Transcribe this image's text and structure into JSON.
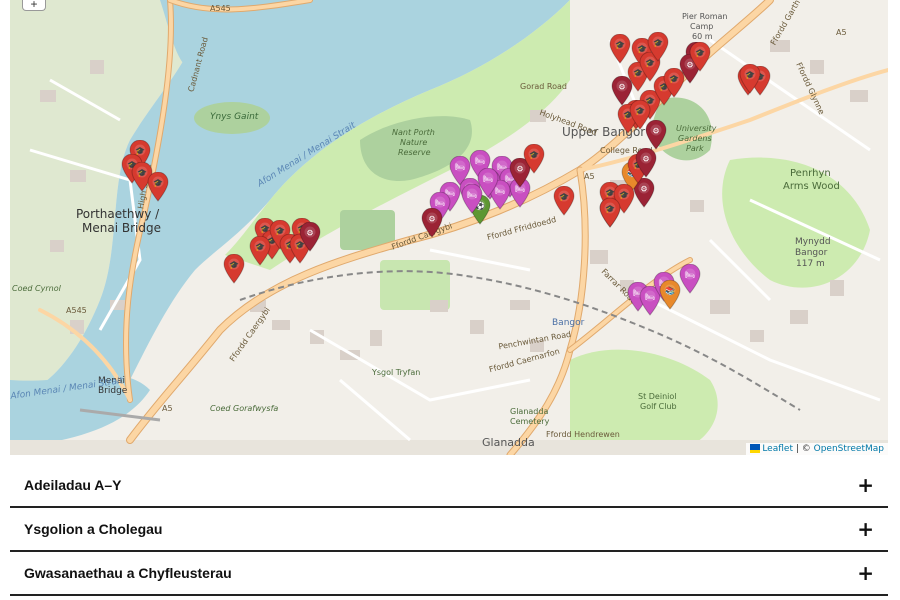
{
  "map": {
    "zoom_in_label": "+",
    "place_labels": [
      {
        "text": "Porthaethwy /",
        "size": 12,
        "color": "#333"
      },
      {
        "text": "Menai Bridge",
        "size": 12,
        "color": "#333"
      },
      {
        "text": "Upper Bangor",
        "size": 12,
        "color": "#555"
      },
      {
        "text": "Bangor",
        "size": 9,
        "color": "#4a6fa5"
      },
      {
        "text": "Glanadda",
        "size": 11,
        "color": "#555"
      },
      {
        "text": "Penrhyn",
        "size": 10,
        "color": "#4a6b3a"
      },
      {
        "text": "Arms Wood",
        "size": 10,
        "color": "#4a6b3a"
      },
      {
        "text": "Mynydd",
        "size": 9,
        "color": "#555"
      },
      {
        "text": "Bangor",
        "size": 9,
        "color": "#555"
      },
      {
        "text": "117 m",
        "size": 9,
        "color": "#555"
      },
      {
        "text": "Ynys Gaint",
        "size": 9,
        "color": "#3a6a3a"
      },
      {
        "text": "Menai",
        "size": 9,
        "color": "#333"
      },
      {
        "text": "Bridge",
        "size": 9,
        "color": "#333"
      },
      {
        "text": "Afon Menai / Menai Strait",
        "size": 9,
        "color": "#5b87b5"
      },
      {
        "text": "Afon Menai / Menai Strait",
        "size": 9,
        "color": "#5b87b5"
      },
      {
        "text": "Nant Porth",
        "size": 8,
        "color": "#4a6b3a"
      },
      {
        "text": "Nature",
        "size": 8,
        "color": "#4a6b3a"
      },
      {
        "text": "Reserve",
        "size": 8,
        "color": "#4a6b3a"
      },
      {
        "text": "St Deiniol",
        "size": 8,
        "color": "#4a6b3a"
      },
      {
        "text": "Golf Club",
        "size": 8,
        "color": "#4a6b3a"
      },
      {
        "text": "Coed Gorafwysfa",
        "size": 8,
        "color": "#4a6b3a"
      },
      {
        "text": "Ysgol Tryfan",
        "size": 8,
        "color": "#4a6b3a"
      },
      {
        "text": "Glanadda",
        "size": 8,
        "color": "#4a6b3a"
      },
      {
        "text": "Cemetery",
        "size": 8,
        "color": "#4a6b3a"
      },
      {
        "text": "University",
        "size": 8,
        "color": "#4a6b3a"
      },
      {
        "text": "Gardens",
        "size": 8,
        "color": "#4a6b3a"
      },
      {
        "text": "Park",
        "size": 8,
        "color": "#4a6b3a"
      },
      {
        "text": "Pier Roman",
        "size": 8,
        "color": "#555"
      },
      {
        "text": "Camp",
        "size": 8,
        "color": "#555"
      },
      {
        "text": "60 m",
        "size": 8,
        "color": "#555"
      },
      {
        "text": "Coed Cyrnol",
        "size": 8,
        "color": "#4a6b3a"
      }
    ],
    "road_labels": [
      "A545",
      "A545",
      "A5",
      "A5",
      "A5",
      "Ffordd Caergybi",
      "Ffordd Caergybi",
      "Ffordd Caernarfon",
      "Farrar Road",
      "Ffordd Ffriddoedd",
      "Penchwintan Road",
      "Gorad Road",
      "Holyhead Road",
      "College Road",
      "Ffordd Garth",
      "Ffordd Glynne",
      "High Street",
      "Cadnant Road",
      "Ffordd Hendrewen"
    ],
    "markers": [
      {
        "type": "education",
        "color": "#d63a2f"
      },
      {
        "type": "education",
        "color": "#d63a2f"
      },
      {
        "type": "education",
        "color": "#d63a2f"
      },
      {
        "type": "education",
        "color": "#d63a2f"
      },
      {
        "type": "education",
        "color": "#d63a2f"
      },
      {
        "type": "education",
        "color": "#d63a2f"
      },
      {
        "type": "education",
        "color": "#d63a2f"
      },
      {
        "type": "education",
        "color": "#d63a2f"
      },
      {
        "type": "education",
        "color": "#d63a2f"
      },
      {
        "type": "education",
        "color": "#d63a2f"
      },
      {
        "type": "education",
        "color": "#d63a2f"
      },
      {
        "type": "education",
        "color": "#d63a2f"
      },
      {
        "type": "service",
        "color": "#9b2335"
      },
      {
        "type": "sport",
        "color": "#5e9732"
      },
      {
        "type": "accommodation",
        "color": "#c94fc1"
      },
      {
        "type": "accommodation",
        "color": "#c94fc1"
      },
      {
        "type": "accommodation",
        "color": "#c94fc1"
      },
      {
        "type": "accommodation",
        "color": "#c94fc1"
      },
      {
        "type": "accommodation",
        "color": "#c94fc1"
      },
      {
        "type": "accommodation",
        "color": "#c94fc1"
      },
      {
        "type": "accommodation",
        "color": "#c94fc1"
      },
      {
        "type": "accommodation",
        "color": "#c94fc1"
      },
      {
        "type": "accommodation",
        "color": "#c94fc1"
      },
      {
        "type": "accommodation",
        "color": "#c94fc1"
      },
      {
        "type": "accommodation",
        "color": "#c94fc1"
      },
      {
        "type": "accommodation",
        "color": "#c94fc1"
      },
      {
        "type": "service",
        "color": "#9b2335"
      },
      {
        "type": "education",
        "color": "#d63a2f"
      },
      {
        "type": "education",
        "color": "#d63a2f"
      },
      {
        "type": "service",
        "color": "#9b2335"
      },
      {
        "type": "education",
        "color": "#d63a2f"
      },
      {
        "type": "education",
        "color": "#d63a2f"
      },
      {
        "type": "service",
        "color": "#9b2335"
      },
      {
        "type": "education",
        "color": "#d63a2f"
      },
      {
        "type": "education",
        "color": "#d63a2f"
      },
      {
        "type": "education",
        "color": "#d63a2f"
      },
      {
        "type": "education",
        "color": "#d63a2f"
      },
      {
        "type": "education",
        "color": "#d63a2f"
      },
      {
        "type": "education",
        "color": "#d63a2f"
      },
      {
        "type": "education",
        "color": "#d63a2f"
      },
      {
        "type": "education",
        "color": "#d63a2f"
      },
      {
        "type": "education",
        "color": "#d63a2f"
      },
      {
        "type": "service",
        "color": "#9b2335"
      },
      {
        "type": "service",
        "color": "#9b2335"
      },
      {
        "type": "service",
        "color": "#9b2335"
      },
      {
        "type": "education",
        "color": "#d63a2f"
      },
      {
        "type": "education",
        "color": "#d63a2f"
      },
      {
        "type": "education",
        "color": "#d63a2f"
      },
      {
        "type": "service",
        "color": "#9b2335"
      },
      {
        "type": "library",
        "color": "#e8892b"
      },
      {
        "type": "education",
        "color": "#d63a2f"
      },
      {
        "type": "education",
        "color": "#d63a2f"
      },
      {
        "type": "education",
        "color": "#d63a2f"
      },
      {
        "type": "service",
        "color": "#9b2335"
      },
      {
        "type": "education",
        "color": "#d63a2f"
      },
      {
        "type": "education",
        "color": "#d63a2f"
      },
      {
        "type": "education",
        "color": "#d63a2f"
      },
      {
        "type": "accommodation",
        "color": "#c94fc1"
      },
      {
        "type": "accommodation",
        "color": "#c94fc1"
      },
      {
        "type": "accommodation",
        "color": "#c94fc1"
      },
      {
        "type": "accommodation",
        "color": "#c94fc1"
      },
      {
        "type": "library",
        "color": "#e8892b"
      }
    ],
    "attribution": {
      "leaflet": "Leaflet",
      "separator": " | © ",
      "osm": "OpenStreetMap"
    },
    "colors": {
      "water": "#aad3df",
      "land": "#f2efe9",
      "green": "#cdebb0",
      "park": "#add19e",
      "road_major": "#fcd6a4",
      "road_major_edge": "#e0a96d"
    }
  },
  "accordion": {
    "items": [
      {
        "title": "Adeiladau A–Y",
        "icon": "+"
      },
      {
        "title": "Ysgolion a Cholegau",
        "icon": "+"
      },
      {
        "title": "Gwasanaethau a Chyfleusterau",
        "icon": "+"
      }
    ]
  }
}
